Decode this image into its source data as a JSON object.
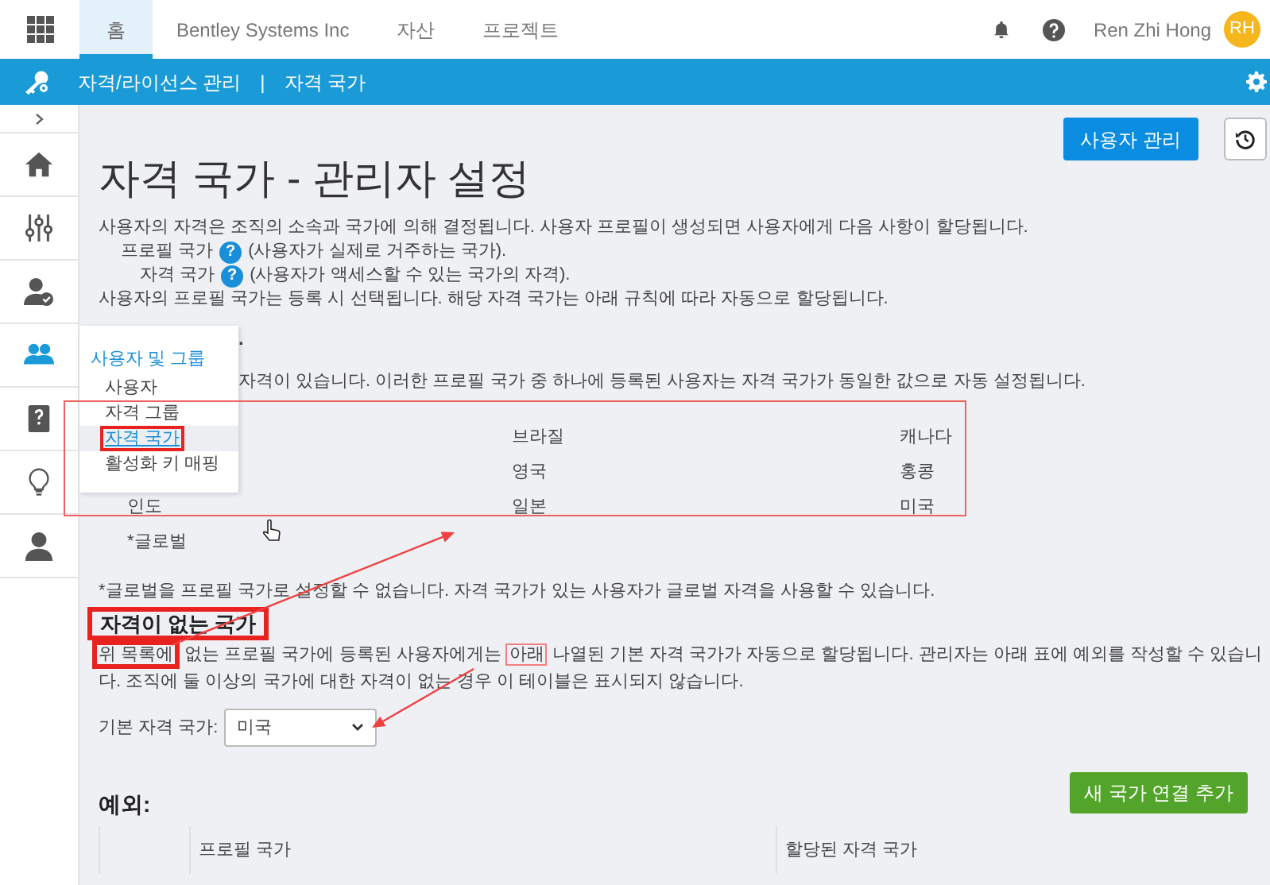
{
  "top_nav": {
    "tabs": [
      {
        "label": "홈",
        "selected": true
      },
      {
        "label": "Bentley Systems Inc",
        "selected": false
      },
      {
        "label": "자산",
        "selected": false
      },
      {
        "label": "프로젝트",
        "selected": false
      }
    ],
    "user_name": "Ren Zhi Hong",
    "avatar_initials": "RH"
  },
  "breadcrumb": {
    "items": [
      "자격/라이선스 관리",
      "자격 국가"
    ],
    "separator": "|"
  },
  "side_rail": {
    "items": [
      {
        "kind": "home",
        "selected": false
      },
      {
        "kind": "sliders",
        "selected": false
      },
      {
        "kind": "user-check",
        "selected": false
      },
      {
        "kind": "users",
        "selected": true
      },
      {
        "kind": "book",
        "selected": false
      },
      {
        "kind": "bulb",
        "selected": false
      },
      {
        "kind": "person",
        "selected": false
      }
    ]
  },
  "flyout_menu": {
    "title": "사용자 및 그룹",
    "items": [
      {
        "label": "사용자",
        "selected": false,
        "highlighted": false
      },
      {
        "label": "자격 그룹",
        "selected": false,
        "highlighted": false
      },
      {
        "label": "자격 국가",
        "selected": true,
        "highlighted": true
      },
      {
        "label": "활성화 키 매핑",
        "selected": false,
        "highlighted": false
      }
    ]
  },
  "page": {
    "manage_users_button": "사용자 관리",
    "title": "자격 국가 - 관리자 설정",
    "intro": "사용자의 자격은 조직의 소속과 국가에 의해 결정됩니다. 사용자 프로필이 생성되면 사용자에게 다음 사항이 할당됩니다.",
    "definitions": [
      {
        "term": "프로필 국가",
        "help": "?",
        "description": "(사용자가 실제로 거주하는 국가)."
      },
      {
        "term": "자격 국가",
        "help": "?",
        "description": "(사용자가 액세스할 수 있는 국가의 자격)."
      }
    ],
    "note": "사용자의 프로필 국가는 등록 시 선택됩니다. 해당 자격 국가는 아래 규칙에 따라 자동으로 할당됩니다.",
    "heading_fragment": ".",
    "rule_fragment": "자격이 있습니다. 이러한 프로필 국가 중 하나에 등록된 사용자는 자격 국가가 동일한 값으로 자동 설정됩니다.",
    "country_table": {
      "highlighted": true,
      "rows": [
        {
          "column_2": "브라질",
          "column_3": "캐나다"
        },
        {
          "column_2": "영국",
          "column_3": "홍콩"
        },
        {
          "column_1": "인도",
          "column_2": "일본",
          "column_3": "미국"
        }
      ]
    },
    "global_item": "*글로벌",
    "global_note": "*글로벌을 프로필 국가로 설정할 수 없습니다. 자격 국가가 있는 사용자가 글로벌 자격을 사용할 수 있습니다.",
    "no_entitlement": {
      "heading": "자격이 없는 국가",
      "heading_highlighted": true,
      "paragraph": [
        {
          "text": "위 목록에",
          "highlighted": true
        },
        {
          "text": " 없는 프로필 국가에 등록된 사용자에게는 ",
          "highlighted": false
        },
        {
          "text": "아래",
          "highlighted": true
        },
        {
          "text": " 나열된 기본 자격 국가가 자동으로 할당됩니다. 관리자는 아래 표에 예외를 작성할 수 있습니다. 조직에 둘 이상의 국가에 대한 자격이 없는 경우 이 테이블은 표시되지 않습니다.",
          "highlighted": false
        }
      ],
      "default_label": "기본 자격 국가:",
      "default_value": "미국"
    },
    "exceptions": {
      "heading": "예외:",
      "add_button": "새 국가 연결 추가",
      "columns": [
        "프로필 국가",
        "할당된 자격 국가"
      ]
    }
  }
}
